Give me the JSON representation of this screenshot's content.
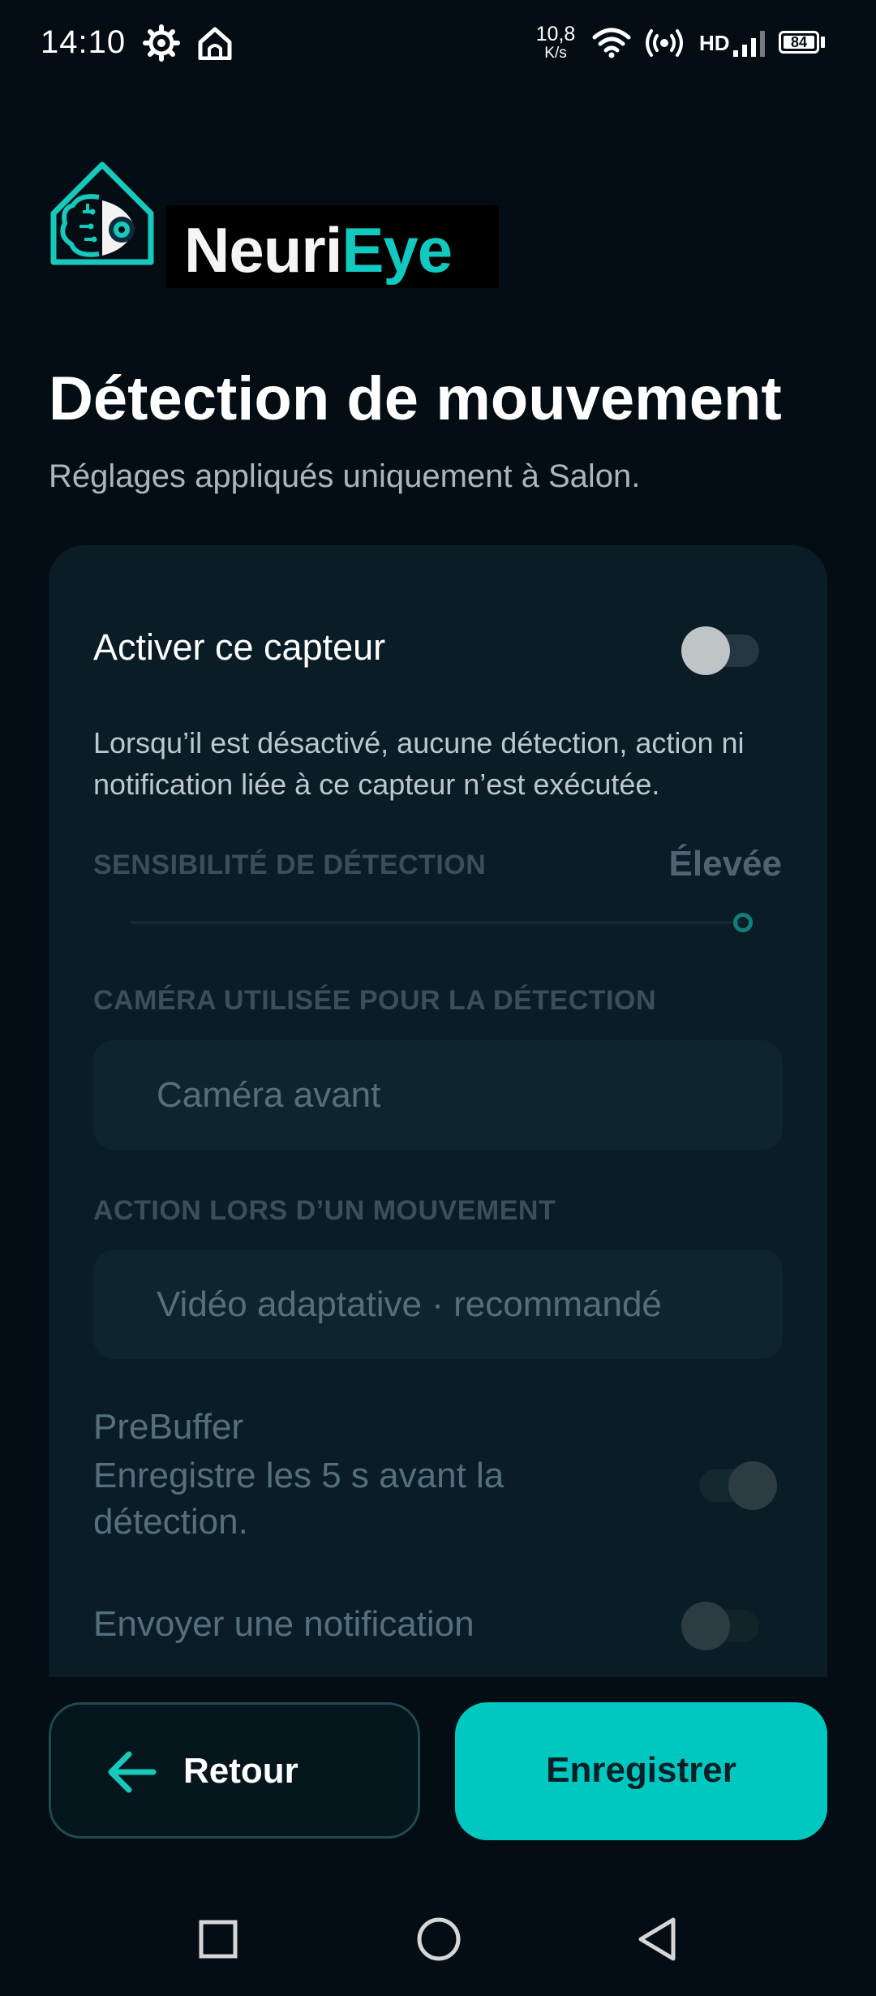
{
  "status_bar": {
    "time": "14:10",
    "net_speed_value": "10,8",
    "net_speed_unit": "K/s",
    "hd_label": "HD",
    "battery": "84",
    "icons": [
      "settings-gear-icon",
      "home-icon",
      "wifi-icon",
      "hotspot-icon",
      "signal-icon",
      "battery-icon"
    ]
  },
  "brand": {
    "part1": "Neuri",
    "part2": "Eye"
  },
  "page": {
    "title": "Détection de mouvement",
    "subtitle": "Réglages appliqués uniquement à Salon."
  },
  "settings": {
    "enable_label": "Activer ce capteur",
    "enable_on": false,
    "enable_description": "Lorsqu’il est désactivé, aucune détection, action ni notification liée à ce capteur n’est exécutée.",
    "sensitivity_header": "SENSIBILITÉ DE DÉTECTION",
    "sensitivity_value": "Élevée",
    "sensitivity_level": 1.0,
    "camera_header": "CAMÉRA UTILISÉE POUR LA DÉTECTION",
    "camera_value": "Caméra avant",
    "action_header": "ACTION LORS D’UN MOUVEMENT",
    "action_value": "Vidéo adaptative · recommandé",
    "prebuffer_title": "PreBuffer",
    "prebuffer_description": "Enregistre les 5 s avant la détection.",
    "prebuffer_on": true,
    "notification_label": "Envoyer une notification",
    "notification_on": false
  },
  "buttons": {
    "back": "Retour",
    "save": "Enregistrer"
  },
  "colors": {
    "accent": "#00c8c0",
    "background": "#030d13",
    "card": "#0a1d26"
  }
}
